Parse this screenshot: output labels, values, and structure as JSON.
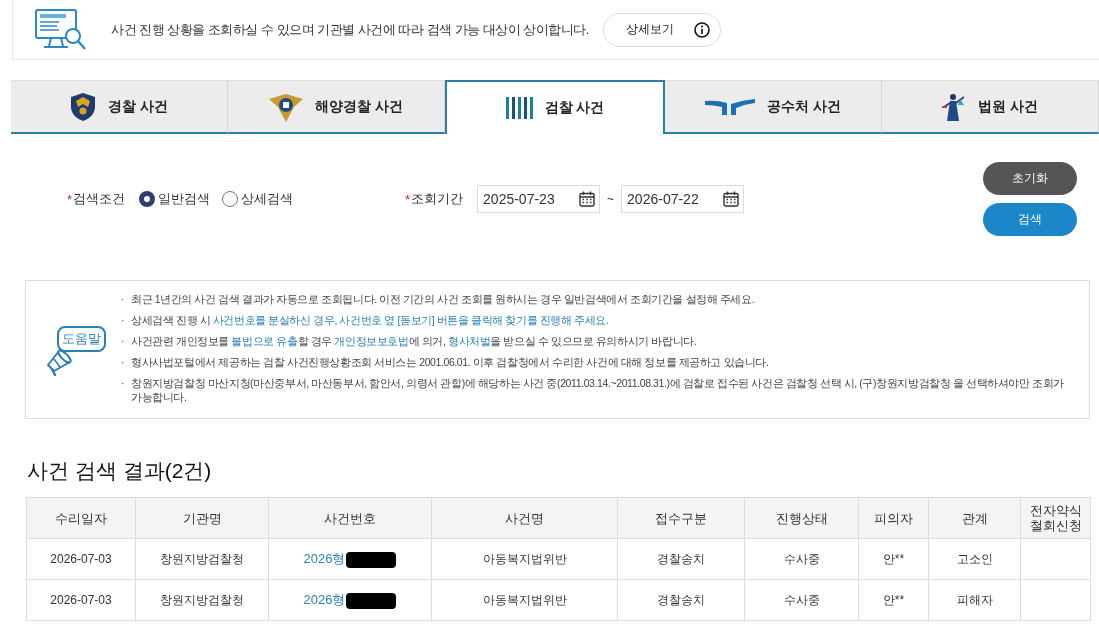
{
  "notice": {
    "text": "사건 진행 상황을 조회하실 수 있으며 기관별 사건에 따라 검색 가능 대상이 상이합니다.",
    "button": "상세보기"
  },
  "tabs": [
    {
      "label": "경찰 사건",
      "kind": "police",
      "selected": false
    },
    {
      "label": "해양경찰 사건",
      "kind": "coastguard",
      "selected": false
    },
    {
      "label": "검찰 사건",
      "kind": "prosecution",
      "selected": true
    },
    {
      "label": "공수처 사건",
      "kind": "cio",
      "selected": false
    },
    {
      "label": "법원 사건",
      "kind": "court",
      "selected": false
    }
  ],
  "search": {
    "condition": {
      "mark": "*",
      "label": "검색조건",
      "options": [
        {
          "label": "일반검색",
          "selected": true
        },
        {
          "label": "상세검색",
          "selected": false
        }
      ]
    },
    "period": {
      "mark": "*",
      "label": "조회기간",
      "from": "2025-07-23",
      "separator": "~",
      "to": "2026-07-22"
    },
    "buttons": [
      {
        "label": "초기화",
        "kind": "reset"
      },
      {
        "label": "검색",
        "kind": "search"
      }
    ]
  },
  "help": {
    "badge": "도움말",
    "items": [
      {
        "bullet": "·",
        "segments": [
          {
            "text": "최근 1년간의 사건 검색 결과가 자동으로 조회됩니다. 이전 기간의 사건 조회를 원하시는 경우 일반검색에서 조회기간을 설정해 주세요.",
            "highlight": false
          }
        ]
      },
      {
        "bullet": "·",
        "segments": [
          {
            "text": "상세검색 진행 시 ",
            "highlight": false
          },
          {
            "text": "사건번호를 분실하신 경우, 사건번호 옆 [돋보기] 버튼을 클릭해 찾기를 진행해 주세요.",
            "highlight": true
          }
        ]
      },
      {
        "bullet": "·",
        "segments": [
          {
            "text": "사건관련 개인정보를 ",
            "highlight": false
          },
          {
            "text": "불법으로 유출",
            "highlight": true
          },
          {
            "text": "할 경우 ",
            "highlight": false
          },
          {
            "text": "개인정보보호법",
            "highlight": true
          },
          {
            "text": "에 의거, ",
            "highlight": false
          },
          {
            "text": "형사처벌",
            "highlight": true
          },
          {
            "text": "을 받으실 수 있으므로 유의하시기 바랍니다.",
            "highlight": false
          }
        ]
      },
      {
        "bullet": "·",
        "segments": [
          {
            "text": "형사사법포털에서 제공하는 검찰 사건진행상황조회 서비스는 2001.06.01. 이후 검찰청에서 수리한 사건에 대해 정보를 제공하고 있습니다.",
            "highlight": false
          }
        ]
      },
      {
        "bullet": "·",
        "segments": [
          {
            "text": "창원지방검찰청 마산지청(마산중부서, 마산동부서, 함안서, 의령서 관할)에 해당하는 사건 중(2011.03.14.~2011.08.31.)에 검찰로 접수된 사건은 검찰청 선택 시, (구)창원지방검찰청 을 선택하셔야만 조회가 가능합니다.",
            "highlight": false
          }
        ]
      }
    ]
  },
  "results": {
    "title": "사건 검색 결과(2건)",
    "table": {
      "columns": [
        "수리일자",
        "기관명",
        "사건번호",
        "사건명",
        "접수구분",
        "진행상태",
        "피의자",
        "관계",
        "전자약식 철회신청"
      ],
      "rows": [
        {
          "received_date": "2026-07-03",
          "agency": "창원지방검찰청",
          "case_number": {
            "text": "2026형",
            "redacted": true
          },
          "case_name": "아동복지법위반",
          "intake": "경찰송치",
          "status": "수사중",
          "suspect": "안**",
          "relation": "고소인"
        },
        {
          "received_date": "2026-07-03",
          "agency": "창원지방검찰청",
          "case_number": {
            "text": "2026형",
            "redacted": true
          },
          "case_name": "아동복지법위반",
          "intake": "경찰송치",
          "status": "수사중",
          "suspect": "안**",
          "relation": "피해자"
        }
      ]
    }
  }
}
